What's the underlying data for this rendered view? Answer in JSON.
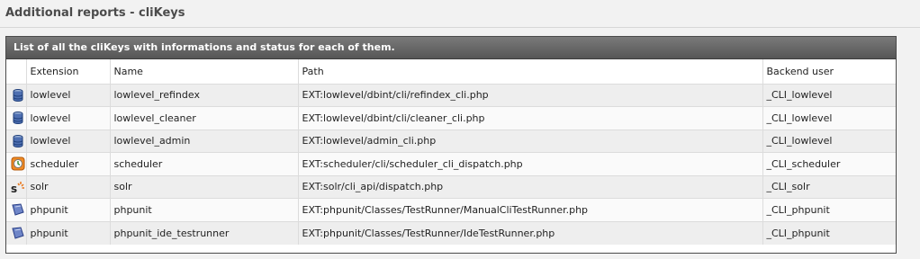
{
  "page": {
    "title": "Additional reports - cliKeys"
  },
  "table": {
    "caption": "List of all the cliKeys with informations and status for each of them.",
    "headers": {
      "extension": "Extension",
      "name": "Name",
      "path": "Path",
      "backend_user": "Backend user"
    },
    "rows": [
      {
        "icon": "database-icon",
        "extension": "lowlevel",
        "name": "lowlevel_refindex",
        "path": "EXT:lowlevel/dbint/cli/refindex_cli.php",
        "backend_user": "_CLI_lowlevel"
      },
      {
        "icon": "database-icon",
        "extension": "lowlevel",
        "name": "lowlevel_cleaner",
        "path": "EXT:lowlevel/dbint/cli/cleaner_cli.php",
        "backend_user": "_CLI_lowlevel"
      },
      {
        "icon": "database-icon",
        "extension": "lowlevel",
        "name": "lowlevel_admin",
        "path": "EXT:lowlevel/admin_cli.php",
        "backend_user": "_CLI_lowlevel"
      },
      {
        "icon": "scheduler-clock-icon",
        "extension": "scheduler",
        "name": "scheduler",
        "path": "EXT:scheduler/cli/scheduler_cli_dispatch.php",
        "backend_user": "_CLI_scheduler"
      },
      {
        "icon": "solr-icon",
        "extension": "solr",
        "name": "solr",
        "path": "EXT:solr/cli_api/dispatch.php",
        "backend_user": "_CLI_solr"
      },
      {
        "icon": "phpunit-icon",
        "extension": "phpunit",
        "name": "phpunit",
        "path": "EXT:phpunit/Classes/TestRunner/ManualCliTestRunner.php",
        "backend_user": "_CLI_phpunit"
      },
      {
        "icon": "phpunit-icon",
        "extension": "phpunit",
        "name": "phpunit_ide_testrunner",
        "path": "EXT:phpunit/Classes/TestRunner/IdeTestRunner.php",
        "backend_user": "_CLI_phpunit"
      }
    ]
  }
}
